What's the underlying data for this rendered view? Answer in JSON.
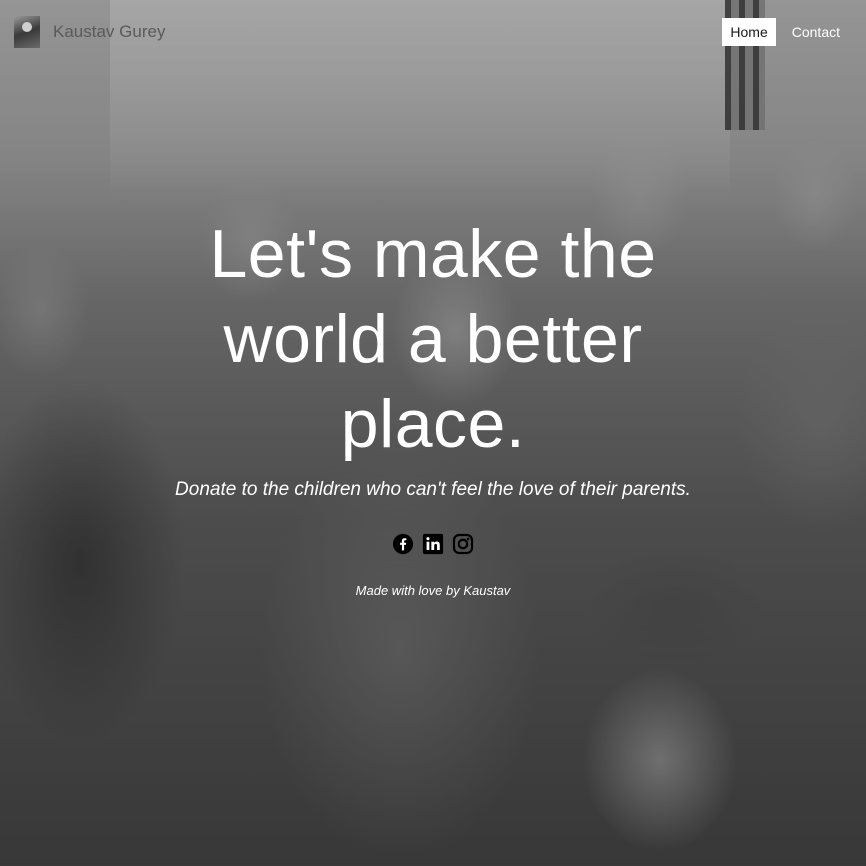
{
  "navbar": {
    "brand_name": "Kaustav Gurey",
    "links": [
      {
        "label": "Home",
        "active": true
      },
      {
        "label": "Contact",
        "active": false
      }
    ]
  },
  "hero": {
    "headline": "Let's make the world a better place.",
    "subheadline": "Donate to the children who can't feel the love of their parents.",
    "socials": [
      {
        "icon": "facebook-icon"
      },
      {
        "icon": "linkedin-icon"
      },
      {
        "icon": "instagram-icon"
      }
    ],
    "footer_note": "Made with love by Kaustav"
  },
  "colors": {
    "text": "#ffffff",
    "active_nav_bg": "#ffffff",
    "active_nav_text": "#1a1a1a",
    "brand_text": "#5a5a5a"
  }
}
